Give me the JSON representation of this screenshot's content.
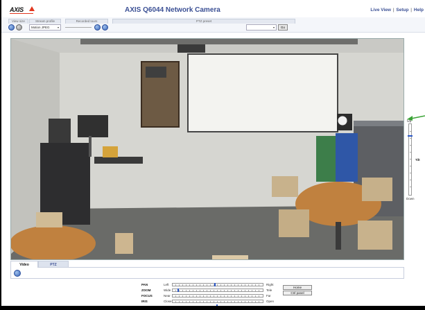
{
  "header": {
    "logo_text": "AXIS",
    "title": "AXIS Q6044 Network Camera",
    "nav": {
      "live_view": "Live View",
      "separator": "|",
      "setup": "Setup",
      "help": "Help"
    }
  },
  "toolbar": {
    "view_size_label": "View size",
    "stream_profile_label": "Stream profile",
    "stream_profile_value": "Motion JPEG",
    "recorded_tours_label": "Recorded tours",
    "ptz_preset_label": "PTZ preset",
    "go_label": "Go"
  },
  "tilt": {
    "up": "Up",
    "label": "Tilt",
    "down": "Down"
  },
  "tabs": [
    {
      "label": "Video"
    },
    {
      "label": "PTZ"
    }
  ],
  "ptz": {
    "rows": [
      {
        "name": "PAN",
        "low": "Left",
        "high": "Right"
      },
      {
        "name": "ZOOM",
        "low": "Wide",
        "high": "Tele"
      },
      {
        "name": "FOCUS",
        "low": "Near",
        "high": "Far"
      },
      {
        "name": "IRIS",
        "low": "Close",
        "high": "Open"
      },
      {
        "name": "BRIGHTNESS",
        "low": "",
        "high": ""
      }
    ],
    "home_label": "Home",
    "ctrl_panel_label": "Ctrl panel"
  },
  "colors": {
    "accent": "#3a4f94",
    "brand_red": "#e2361f",
    "control_blue": "#2a57c8",
    "arrow_green": "#3aa335"
  },
  "icons": [
    "view-size-full-icon",
    "view-size-small-icon",
    "play-tour-icon",
    "stop-tour-icon",
    "snapshot-icon",
    "green-arrow-icon"
  ]
}
